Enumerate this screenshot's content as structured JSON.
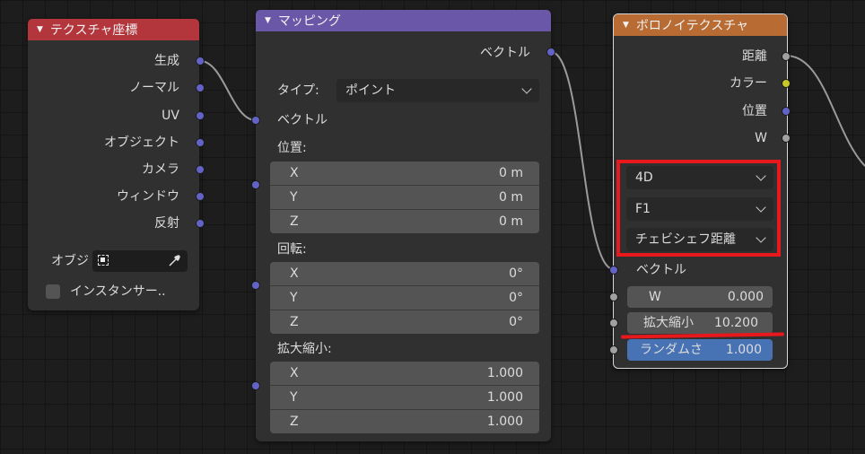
{
  "colors": {
    "tex_coord_header": "#b3363c",
    "mapping_header": "#6b57a8",
    "voronoi_header": "#b86c33",
    "vector_socket": "#6363c7",
    "float_socket": "#a1a1a1",
    "color_socket": "#c7c729",
    "highlight_red": "#e8181c",
    "selected_field": "#4772b3"
  },
  "tex_coord": {
    "title": "テクスチャ座標",
    "outputs": [
      "生成",
      "ノーマル",
      "UV",
      "オブジェクト",
      "カメラ",
      "ウィンドウ",
      "反射"
    ],
    "object_label": "オブジ",
    "instancer_label": "インスタンサー.."
  },
  "mapping": {
    "title": "マッピング",
    "output": "ベクトル",
    "type_label": "タイプ:",
    "type_value": "ポイント",
    "vector_input": "ベクトル",
    "location_label": "位置:",
    "location": [
      {
        "axis": "X",
        "value": "0 m"
      },
      {
        "axis": "Y",
        "value": "0 m"
      },
      {
        "axis": "Z",
        "value": "0 m"
      }
    ],
    "rotation_label": "回転:",
    "rotation": [
      {
        "axis": "X",
        "value": "0°"
      },
      {
        "axis": "Y",
        "value": "0°"
      },
      {
        "axis": "Z",
        "value": "0°"
      }
    ],
    "scale_label": "拡大縮小:",
    "scale": [
      {
        "axis": "X",
        "value": "1.000"
      },
      {
        "axis": "Y",
        "value": "1.000"
      },
      {
        "axis": "Z",
        "value": "1.000"
      }
    ]
  },
  "voronoi": {
    "title": "ボロノイテクスチャ",
    "outputs": [
      "距離",
      "カラー",
      "位置",
      "W"
    ],
    "dimension": "4D",
    "feature": "F1",
    "metric": "チェビシェフ距離",
    "vector_input": "ベクトル",
    "w_label": "W",
    "w_value": "0.000",
    "scale_label": "拡大縮小",
    "scale_value": "10.200",
    "randomness_label": "ランダムさ",
    "randomness_value": "1.000"
  }
}
